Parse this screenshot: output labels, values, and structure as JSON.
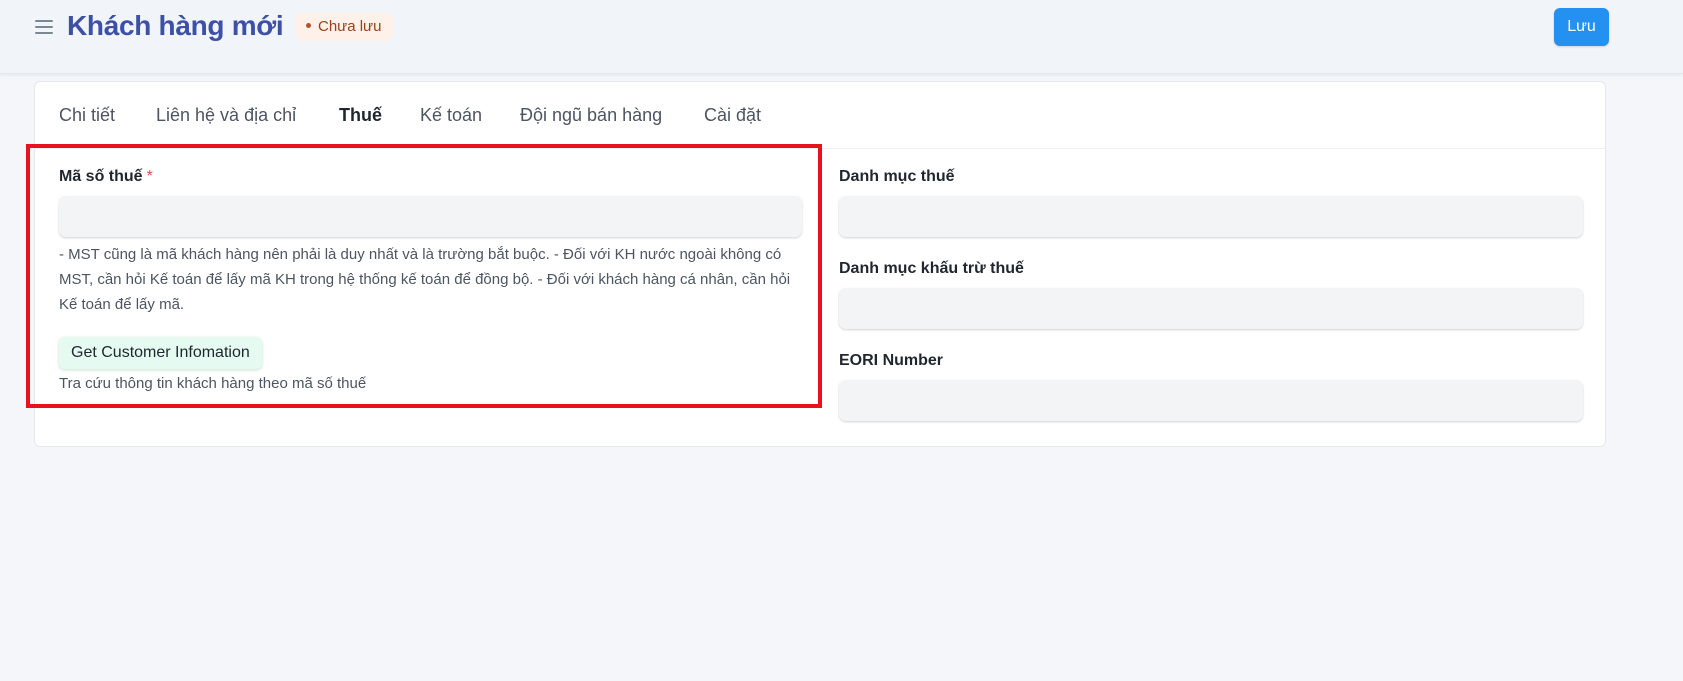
{
  "header": {
    "title": "Khách hàng mới",
    "status": "Chưa lưu",
    "save_label": "Lưu",
    "menu_icon": "hamburger-icon"
  },
  "tabs": [
    {
      "label": "Chi tiết",
      "active": false
    },
    {
      "label": "Liên hệ và địa chỉ",
      "active": false
    },
    {
      "label": "Thuế",
      "active": true
    },
    {
      "label": "Kế toán",
      "active": false
    },
    {
      "label": "Đội ngũ bán hàng",
      "active": false
    },
    {
      "label": "Cài đặt",
      "active": false
    }
  ],
  "left_column": {
    "tax_id_label": "Mã số thuế",
    "tax_id_required": "*",
    "tax_id_value": "",
    "tax_id_help": "- MST cũng là mã khách hàng nên phải là duy nhất và là trường bắt buộc. - Đối với KH nước ngoài không có MST, cần hỏi Kế toán để lấy mã KH trong hệ thống kế toán để đồng bộ. - Đối với khách hàng cá nhân, cần hỏi Kế toán để lấy mã.",
    "lookup_button_label": "Get Customer Infomation",
    "lookup_description": "Tra cứu thông tin khách hàng theo mã số thuế"
  },
  "right_column": {
    "tax_category_label": "Danh mục thuế",
    "tax_category_value": "",
    "tax_withholding_label": "Danh mục khấu trừ thuế",
    "tax_withholding_value": "",
    "eori_label": "EORI Number",
    "eori_value": ""
  },
  "colors": {
    "title": "#3d50a8",
    "primary_button": "#2490ef",
    "status_badge_bg": "#fdf1e9",
    "status_badge_text": "#9a4117",
    "highlight_border": "#e8121f",
    "required_star": "#e24c4c",
    "lookup_button_bg": "#e5faf0"
  }
}
